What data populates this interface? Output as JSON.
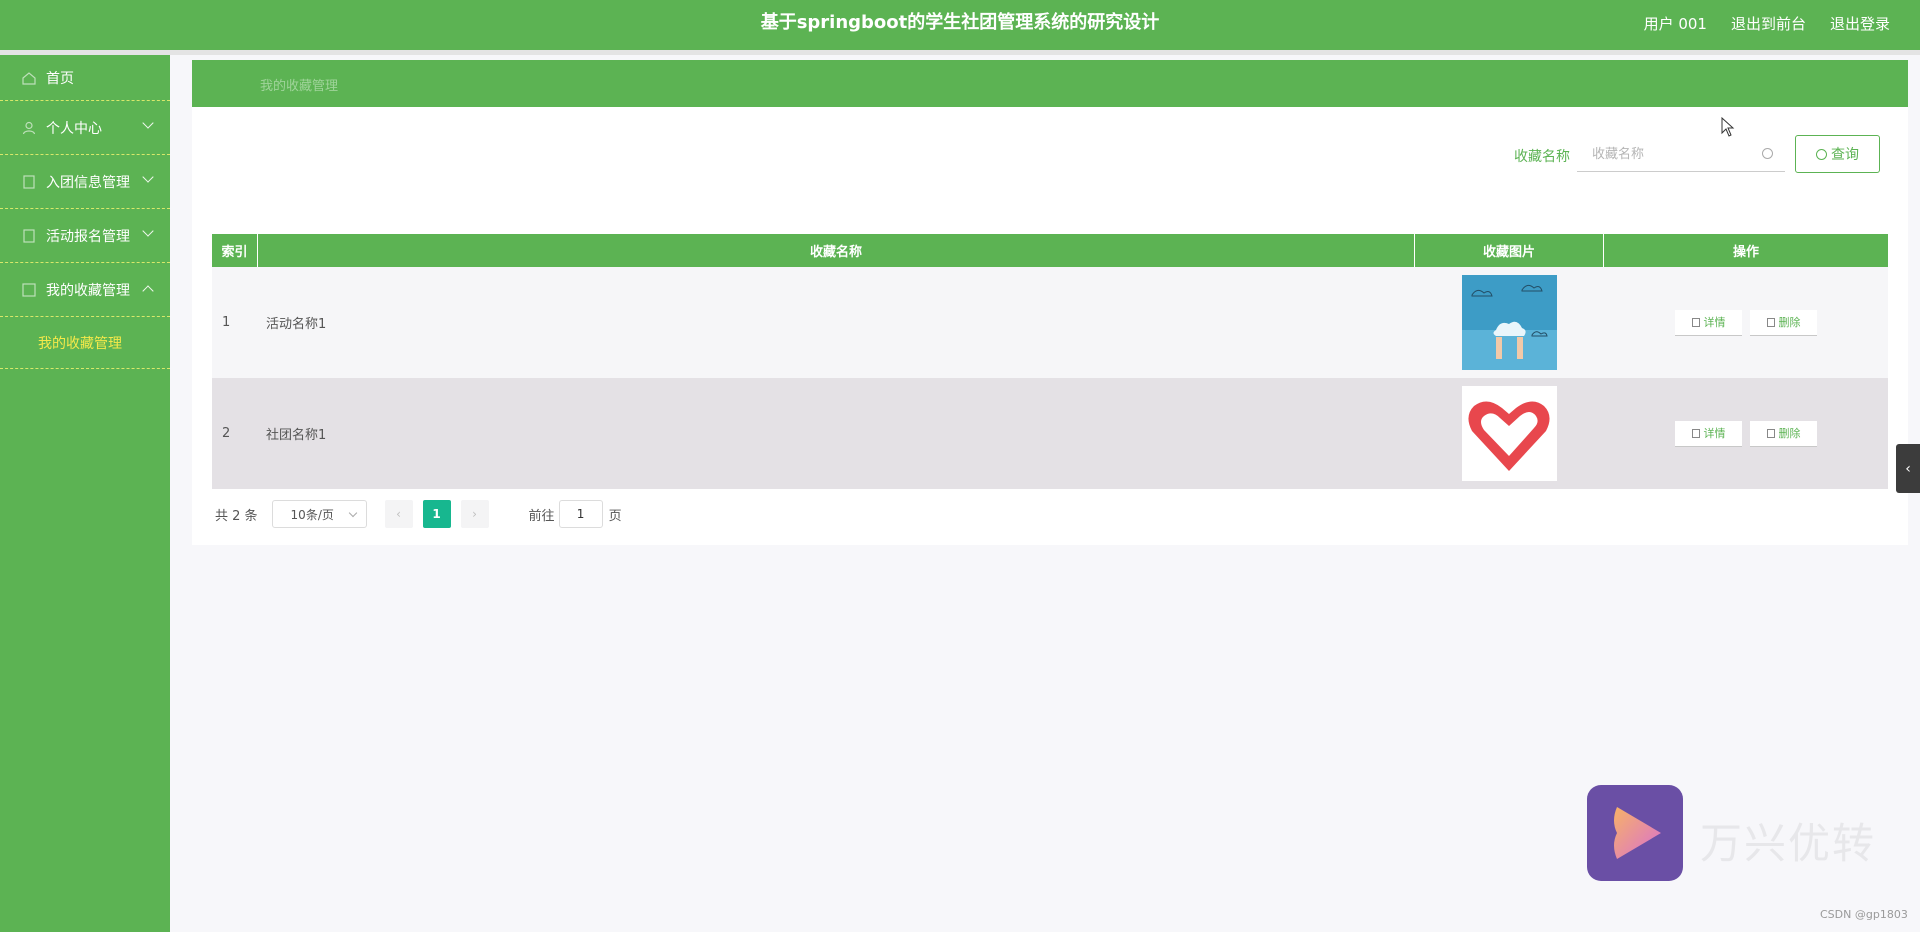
{
  "header": {
    "title": "基于springboot的学生社团管理系统的研究设计",
    "user": "用户 001",
    "to_front": "退出到前台",
    "logout": "退出登录"
  },
  "sidebar": {
    "items": [
      {
        "label": "首页"
      },
      {
        "label": "个人中心"
      },
      {
        "label": "入团信息管理"
      },
      {
        "label": "活动报名管理"
      },
      {
        "label": "我的收藏管理"
      }
    ],
    "sub_items": [
      {
        "label": "我的收藏管理"
      }
    ]
  },
  "breadcrumb": "我的收藏管理",
  "search": {
    "label": "收藏名称",
    "placeholder": "收藏名称",
    "button": "查询"
  },
  "table": {
    "headers": [
      "索引",
      "收藏名称",
      "收藏图片",
      "操作"
    ],
    "rows": [
      {
        "index": "1",
        "name": "活动名称1",
        "image": "cloud-photo"
      },
      {
        "index": "2",
        "name": "社团名称1",
        "image": "heart-hand-logo"
      }
    ],
    "detail_label": "详情",
    "delete_label": "删除"
  },
  "pagination": {
    "total": "共 2 条",
    "page_size": "10条/页",
    "current": "1",
    "goto_label": "前往",
    "goto_value": "1",
    "page_unit": "页"
  },
  "watermark": {
    "text": "万兴优转",
    "credit": "CSDN @gp1803"
  },
  "colors": {
    "primary": "#5cb353",
    "active_page": "#17b78f",
    "active_menu_text": "#f5e94a"
  }
}
